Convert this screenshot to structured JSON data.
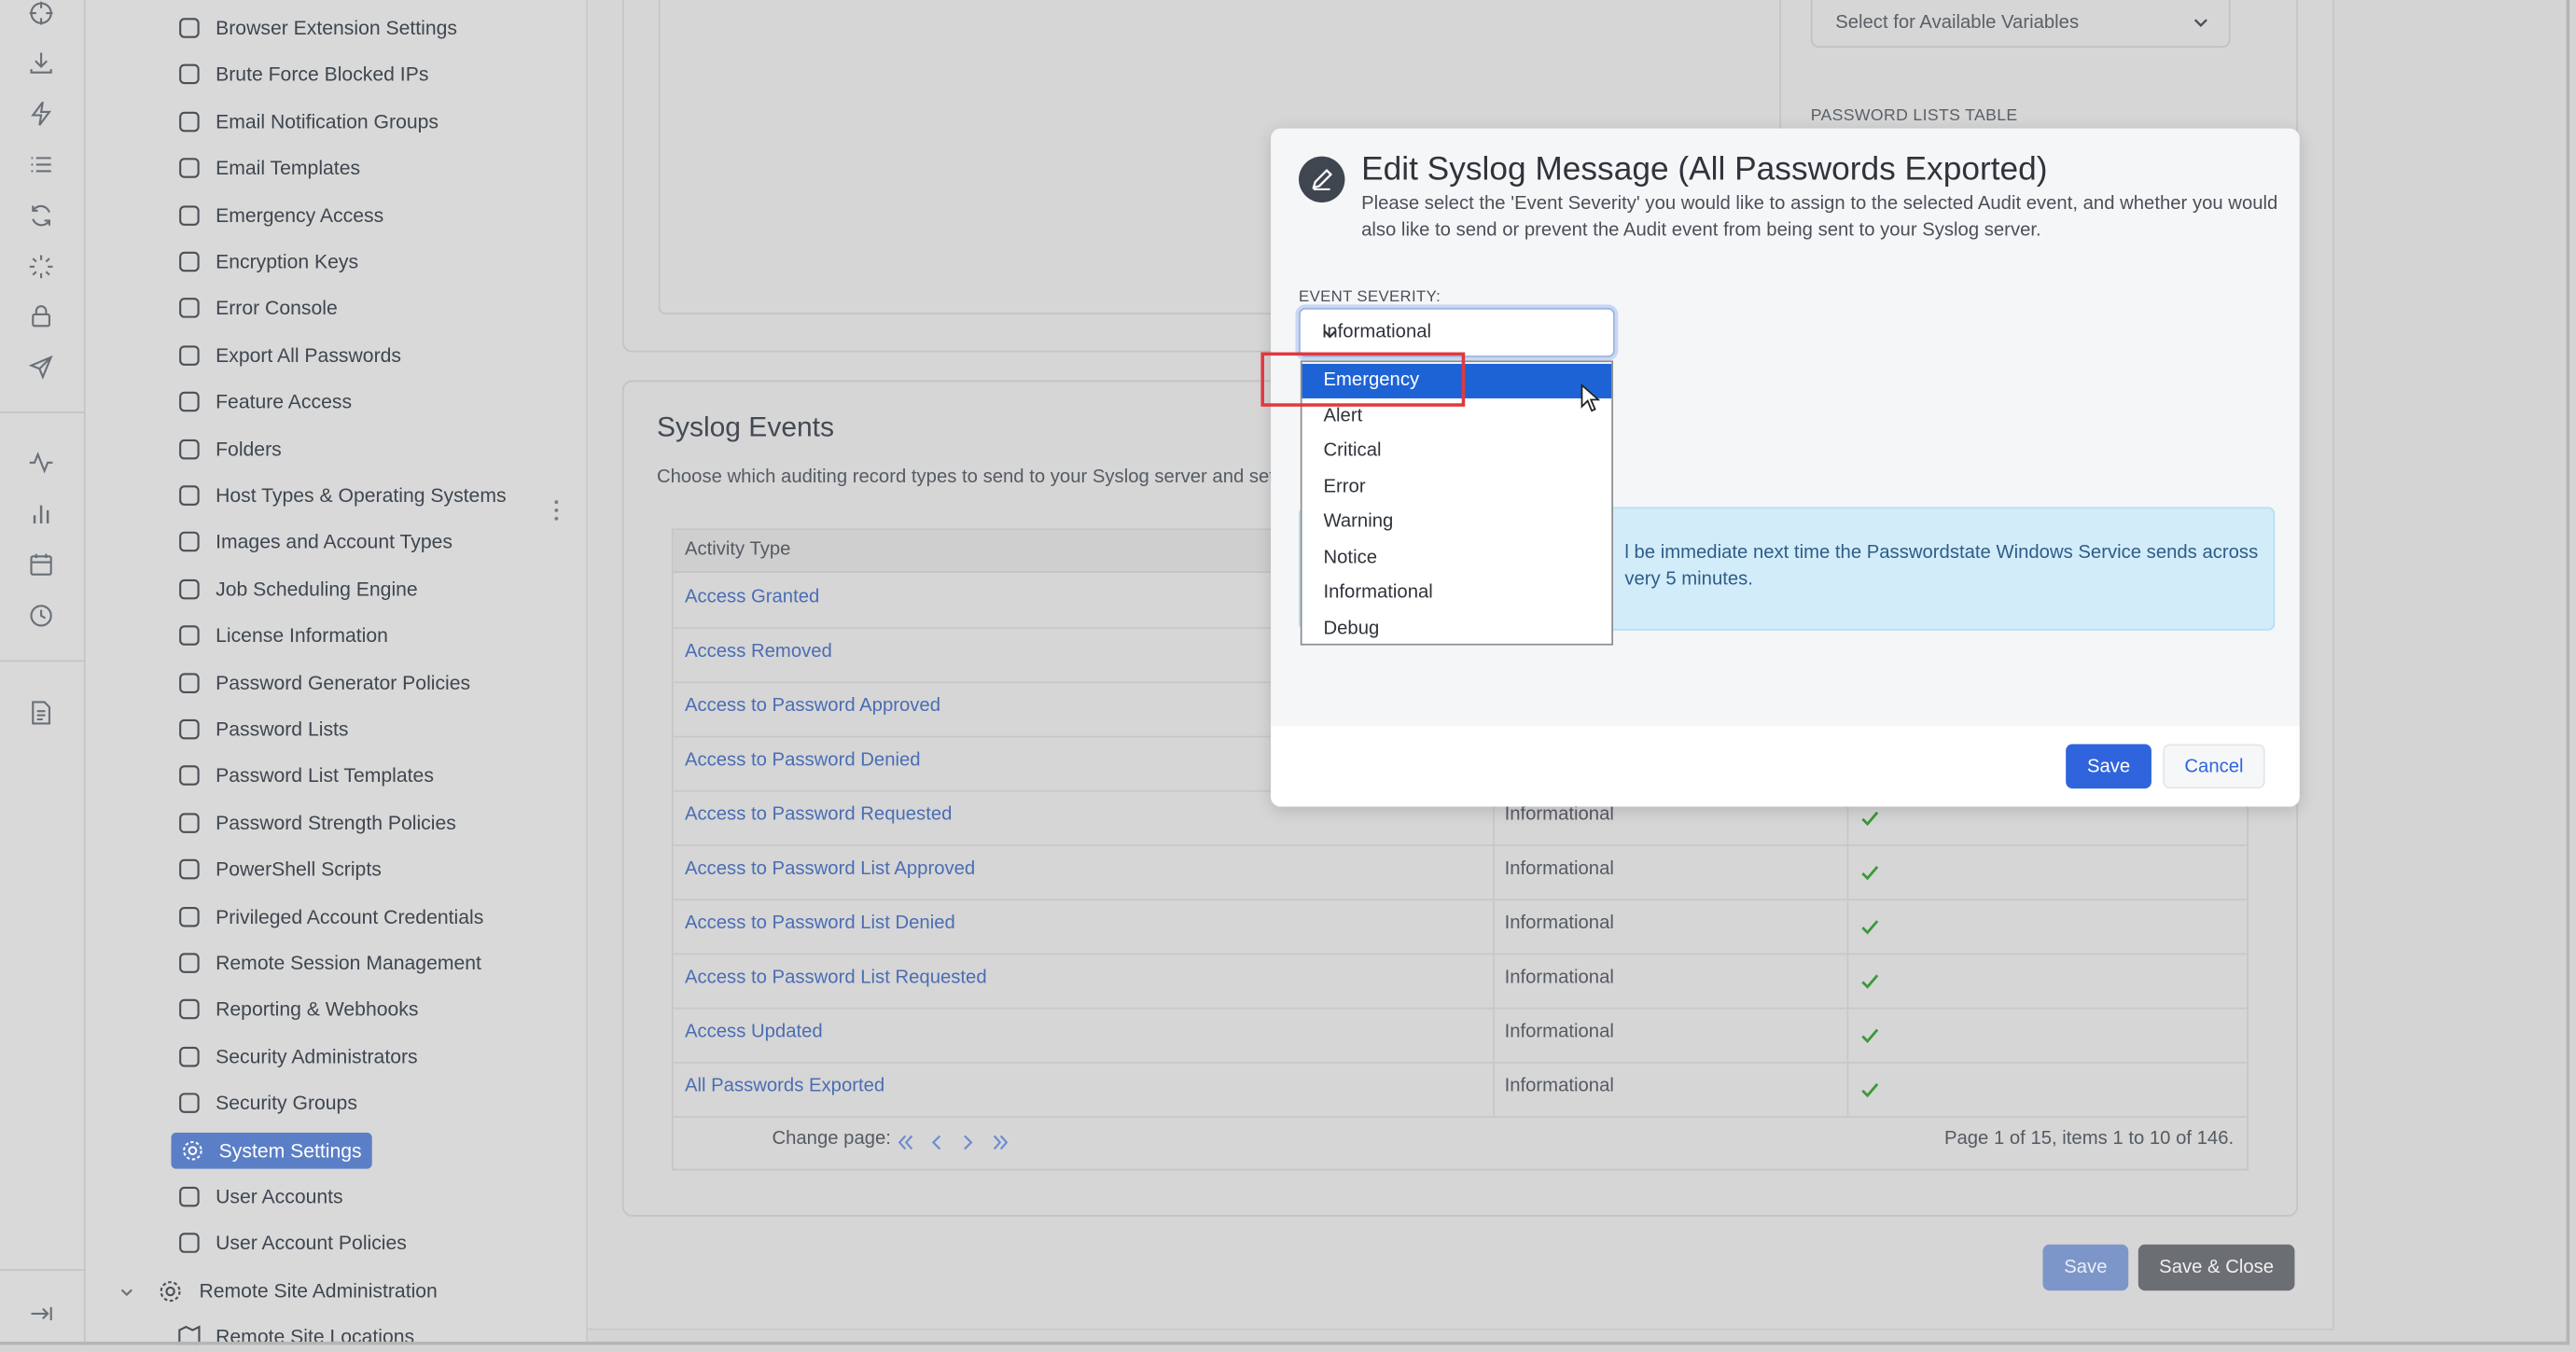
{
  "rail": {
    "icons": [
      "crosshair-icon",
      "download-icon",
      "bolt-icon",
      "list-icon",
      "refresh-icon",
      "spinner-icon",
      "lock-icon",
      "send-icon",
      "activity-icon",
      "bar-chart-icon",
      "calendar-icon",
      "clock-icon",
      "document-icon"
    ],
    "collapse_icon": "collapse-arrow-icon"
  },
  "nav": {
    "items": [
      {
        "label": "Browser Extension Settings",
        "icon": "browser-icon"
      },
      {
        "label": "Brute Force Blocked IPs",
        "icon": "lock-icon"
      },
      {
        "label": "Email Notification Groups",
        "icon": "users-icon"
      },
      {
        "label": "Email Templates",
        "icon": "envelope-icon"
      },
      {
        "label": "Emergency Access",
        "icon": "sign-in-icon"
      },
      {
        "label": "Encryption Keys",
        "icon": "key-icon"
      },
      {
        "label": "Error Console",
        "icon": "warning-icon"
      },
      {
        "label": "Export All Passwords",
        "icon": "export-icon"
      },
      {
        "label": "Feature Access",
        "icon": "eye-off-icon"
      },
      {
        "label": "Folders",
        "icon": "folder-icon"
      },
      {
        "label": "Host Types & Operating Systems",
        "icon": "monitor-icon"
      },
      {
        "label": "Images and Account Types",
        "icon": "image-icon"
      },
      {
        "label": "Job Scheduling Engine",
        "icon": "clock-icon"
      },
      {
        "label": "License Information",
        "icon": "badge-icon"
      },
      {
        "label": "Password Generator Policies",
        "icon": "check-circle-icon"
      },
      {
        "label": "Password Lists",
        "icon": "list-icon"
      },
      {
        "label": "Password List Templates",
        "icon": "grid-icon"
      },
      {
        "label": "Password Strength Policies",
        "icon": "briefcase-icon"
      },
      {
        "label": "PowerShell Scripts",
        "icon": "terminal-icon"
      },
      {
        "label": "Privileged Account Credentials",
        "icon": "user-plus-icon"
      },
      {
        "label": "Remote Session Management",
        "icon": "cast-icon"
      },
      {
        "label": "Reporting & Webhooks",
        "icon": "alert-circle-icon"
      },
      {
        "label": "Security Administrators",
        "icon": "user-check-icon"
      },
      {
        "label": "Security Groups",
        "icon": "shield-icon"
      },
      {
        "label": "System Settings",
        "icon": "gear-icon",
        "active": true
      },
      {
        "label": "User Accounts",
        "icon": "user-icon"
      },
      {
        "label": "User Account Policies",
        "icon": "user-minus-icon"
      }
    ],
    "group": {
      "label": "Remote Site Administration",
      "icon": "gear-icon"
    },
    "partial_item": "Remote Site Locations"
  },
  "top_card": {
    "variables_select": "Select for Available Variables",
    "password_lists_table_label": "PASSWORD LISTS TABLE"
  },
  "syslog": {
    "title": "Syslog Events",
    "description": "Choose which auditing record types to send to your Syslog server and set th",
    "column_activity": "Activity Type",
    "rows": [
      {
        "activity": "Access Granted",
        "severity": "",
        "send": false
      },
      {
        "activity": "Access Removed",
        "severity": "",
        "send": false
      },
      {
        "activity": "Access to Password Approved",
        "severity": "",
        "send": false
      },
      {
        "activity": "Access to Password Denied",
        "severity": "",
        "send": false
      },
      {
        "activity": "Access to Password Requested",
        "severity": "Informational",
        "send": true
      },
      {
        "activity": "Access to Password List Approved",
        "severity": "Informational",
        "send": true
      },
      {
        "activity": "Access to Password List Denied",
        "severity": "Informational",
        "send": true
      },
      {
        "activity": "Access to Password List Requested",
        "severity": "Informational",
        "send": true
      },
      {
        "activity": "Access Updated",
        "severity": "Informational",
        "send": true
      },
      {
        "activity": "All Passwords Exported",
        "severity": "Informational",
        "send": true
      }
    ],
    "pager": {
      "label": "Change page:",
      "info": "Page 1 of 15, items 1 to 10 of 146."
    }
  },
  "page_buttons": {
    "save": "Save",
    "save_close": "Save & Close"
  },
  "modal": {
    "title": "Edit Syslog Message (All Passwords Exported)",
    "icon": "pencil-icon",
    "description": "Please select the 'Event Severity' you would like to assign to the selected Audit event, and whether you would also like to send or prevent the Audit event from being sent to your Syslog server.",
    "severity_label": "EVENT SEVERITY:",
    "severity_value": "Informational",
    "severity_options": [
      "Emergency",
      "Alert",
      "Critical",
      "Error",
      "Warning",
      "Notice",
      "Informational",
      "Debug"
    ],
    "highlighted_option": "Emergency",
    "info_line1": "l be immediate next time the Passwordstate Windows Service sends across",
    "info_line2": "very 5 minutes.",
    "save": "Save",
    "cancel": "Cancel"
  },
  "colors": {
    "accent": "#2f64dd",
    "link": "#4a6db4",
    "dropdown_selected": "#1e63d6",
    "annotation_box": "#e0393e",
    "check": "#3a9a3a"
  }
}
